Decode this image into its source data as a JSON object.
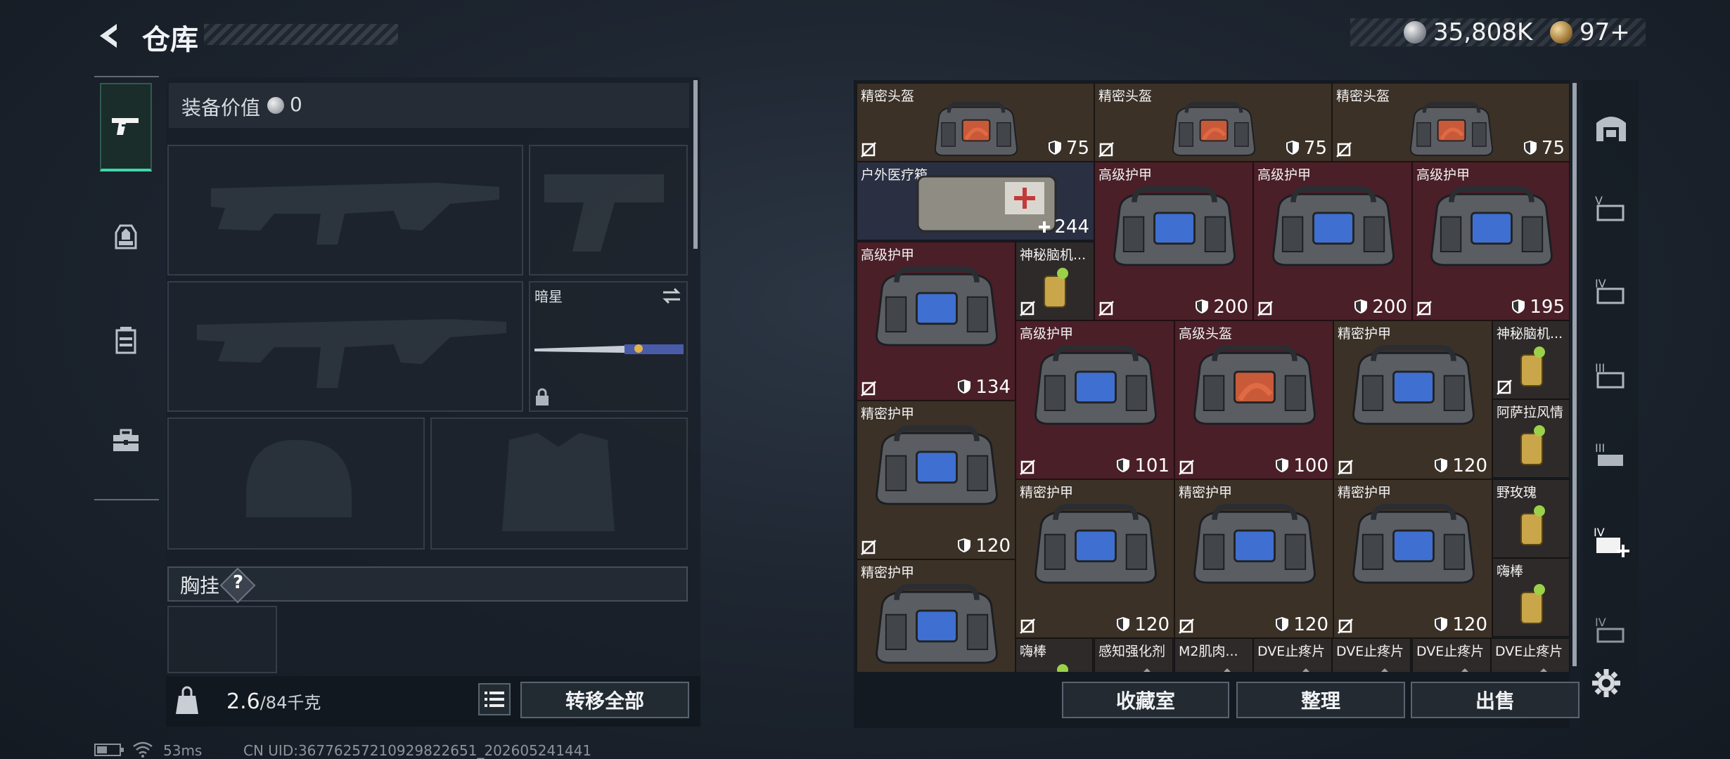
{
  "header": {
    "title": "仓库",
    "currency1": "35,808K",
    "currency2": "97+"
  },
  "loadout": {
    "equip_value_label": "装备价值",
    "equip_value": "0",
    "melee_name": "暗星",
    "chest_label": "胸挂",
    "chest_help": "?",
    "weight_value": "2.6",
    "weight_max": "/84千克",
    "transfer_all": "转移全部"
  },
  "storage": {
    "items": [
      {
        "name": "精密头盔",
        "value": "75",
        "color": "brown"
      },
      {
        "name": "精密头盔",
        "value": "75",
        "color": "brown"
      },
      {
        "name": "精密头盔",
        "value": "75",
        "color": "brown"
      },
      {
        "name": "户外医疗箱",
        "value": "244",
        "color": "blue"
      },
      {
        "name": "高级护甲",
        "value": "200",
        "color": "red"
      },
      {
        "name": "高级护甲",
        "value": "200",
        "color": "red"
      },
      {
        "name": "高级护甲",
        "value": "195",
        "color": "red"
      },
      {
        "name": "高级护甲",
        "value": "134",
        "color": "red"
      },
      {
        "name": "神秘脑机...",
        "value": "",
        "color": "dark"
      },
      {
        "name": "高级护甲",
        "value": "101",
        "color": "red"
      },
      {
        "name": "高级头盔",
        "value": "100",
        "color": "red"
      },
      {
        "name": "精密护甲",
        "value": "120",
        "color": "brown"
      },
      {
        "name": "神秘脑机...",
        "value": "",
        "color": "dark"
      },
      {
        "name": "阿萨拉风情",
        "value": "",
        "color": "dark"
      },
      {
        "name": "精密护甲",
        "value": "120",
        "color": "brown"
      },
      {
        "name": "精密护甲",
        "value": "120",
        "color": "brown"
      },
      {
        "name": "精密护甲",
        "value": "120",
        "color": "brown"
      },
      {
        "name": "精密护甲",
        "value": "120",
        "color": "brown"
      },
      {
        "name": "野玫瑰",
        "value": "",
        "color": "dark"
      },
      {
        "name": "嗨棒",
        "value": "",
        "color": "dark"
      },
      {
        "name": "精密护甲",
        "value": "",
        "color": "brown"
      },
      {
        "name": "嗨棒",
        "value": "",
        "color": "dark"
      },
      {
        "name": "感知强化剂",
        "value": "",
        "color": "dark"
      },
      {
        "name": "M2肌肉...",
        "value": "",
        "color": "dark"
      },
      {
        "name": "DVE止疼片",
        "value": "",
        "color": "dark"
      },
      {
        "name": "DVE止疼片",
        "value": "",
        "color": "dark"
      },
      {
        "name": "DVE止疼片",
        "value": "",
        "color": "dark"
      },
      {
        "name": "DVE止疼片",
        "value": "",
        "color": "dark"
      }
    ],
    "buttons": {
      "collection": "收藏室",
      "sort": "整理",
      "sell": "出售"
    }
  },
  "status": {
    "ping": "53ms",
    "uid": "CN UID:3677625721092982265​1_202605241441"
  },
  "icons": [
    "back-icon",
    "silver-coin-icon",
    "gold-coin-icon",
    "pistol-icon",
    "backpack-icon",
    "chest-rig-icon",
    "toolbox-icon",
    "lock-icon",
    "swap-icon",
    "list-icon",
    "settings-icon",
    "battery-icon",
    "wifi-icon"
  ]
}
